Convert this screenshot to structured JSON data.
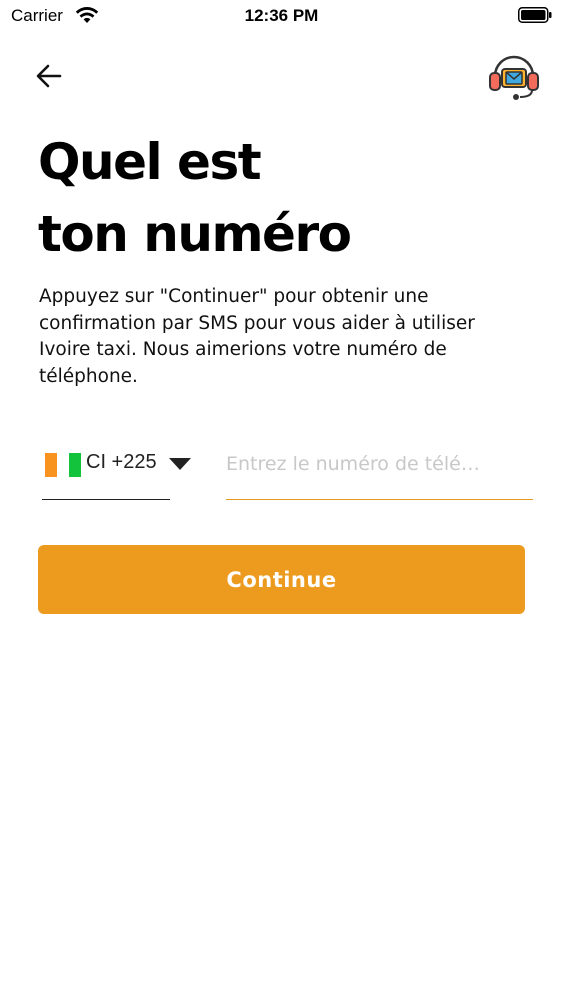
{
  "status_bar": {
    "carrier": "Carrier",
    "time": "12:36 PM"
  },
  "icons": {
    "back": "arrow-left-icon",
    "support": "headset-support-icon",
    "wifi": "wifi-icon",
    "battery": "battery-icon",
    "dropdown": "chevron-down-icon"
  },
  "title": {
    "line1": "Quel est",
    "line2": "ton numéro"
  },
  "description": "Appuyez sur \"Continuer\" pour obtenir une confirmation par SMS pour vous aider à utiliser Ivoire taxi. Nous aimerions votre numéro de téléphone.",
  "phone": {
    "country_code": "CI +225",
    "placeholder": "Entrez le numéro de télé…",
    "value": ""
  },
  "colors": {
    "accent": "#ec9b1e",
    "flag_orange": "#f7931e",
    "flag_green": "#12c33b"
  },
  "continue_label": "Continue"
}
